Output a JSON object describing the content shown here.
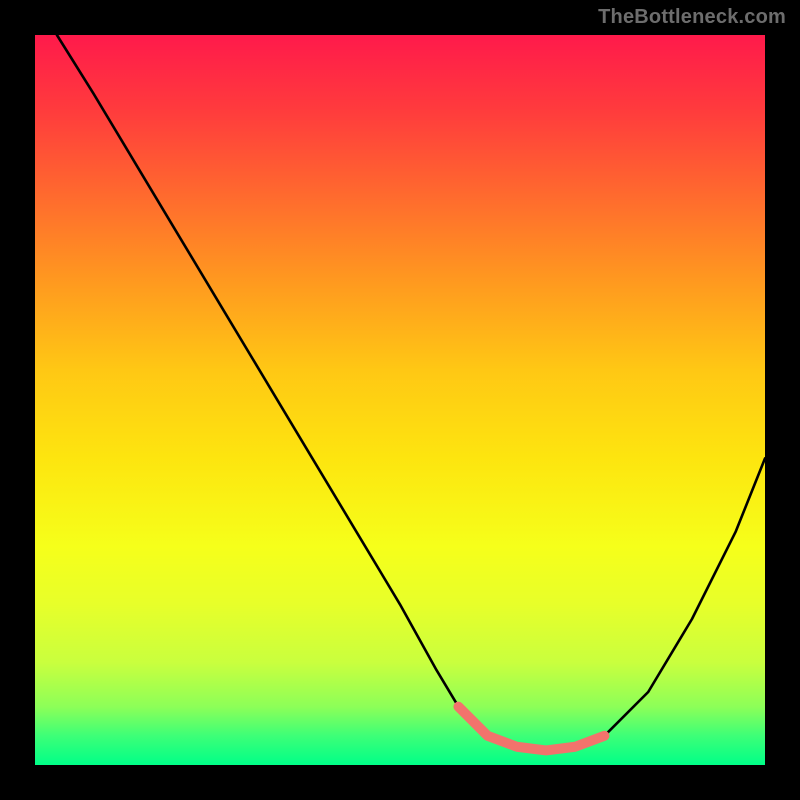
{
  "watermark": "TheBottleneck.com",
  "chart_data": {
    "type": "line",
    "title": "",
    "xlabel": "",
    "ylabel": "",
    "xlim": [
      0,
      100
    ],
    "ylim": [
      0,
      100
    ],
    "grid": false,
    "legend": false,
    "series": [
      {
        "name": "curve",
        "x": [
          3,
          8,
          14,
          20,
          26,
          32,
          38,
          44,
          50,
          55,
          58,
          62,
          66,
          70,
          74,
          78,
          84,
          90,
          96,
          100
        ],
        "y": [
          100,
          92,
          82,
          72,
          62,
          52,
          42,
          32,
          22,
          13,
          8,
          4,
          2.5,
          2,
          2.5,
          4,
          10,
          20,
          32,
          42
        ]
      },
      {
        "name": "highlight",
        "x": [
          58,
          62,
          66,
          70,
          74,
          78
        ],
        "y": [
          8,
          4,
          2.5,
          2,
          2.5,
          4
        ]
      }
    ],
    "colors": {
      "curve": "#000000",
      "highlight": "#f2736c"
    }
  }
}
